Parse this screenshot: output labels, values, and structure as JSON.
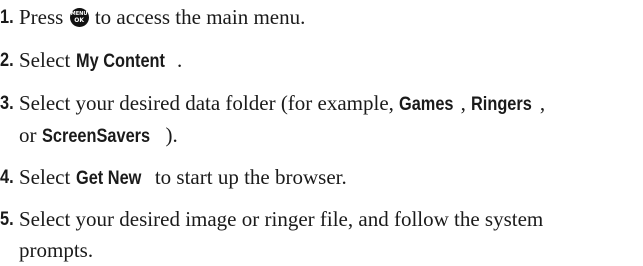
{
  "steps": [
    {
      "number": "1.",
      "before": "Press ",
      "key": {
        "icon": "menu-ok-key-icon",
        "top_label": "MENU",
        "bottom_label": "OK"
      },
      "after": " to access the main menu."
    },
    {
      "number": "2.",
      "before": "Select ",
      "keyword": "My Content",
      "after": "."
    },
    {
      "number": "3.",
      "line1_before": "Select your desired data folder (for example, ",
      "kw_games": "Games",
      "comma1": ", ",
      "kw_ringers": "Ringers",
      "comma2": ",",
      "line2_before": "or ",
      "kw_screensavers": "ScreenSavers",
      "line2_after": ")."
    },
    {
      "number": "4.",
      "before": "Select ",
      "keyword": "Get New",
      "after": " to start up the browser."
    },
    {
      "number": "5.",
      "line1": "Select your desired image or ringer file, and follow the system",
      "line2": "prompts."
    }
  ]
}
